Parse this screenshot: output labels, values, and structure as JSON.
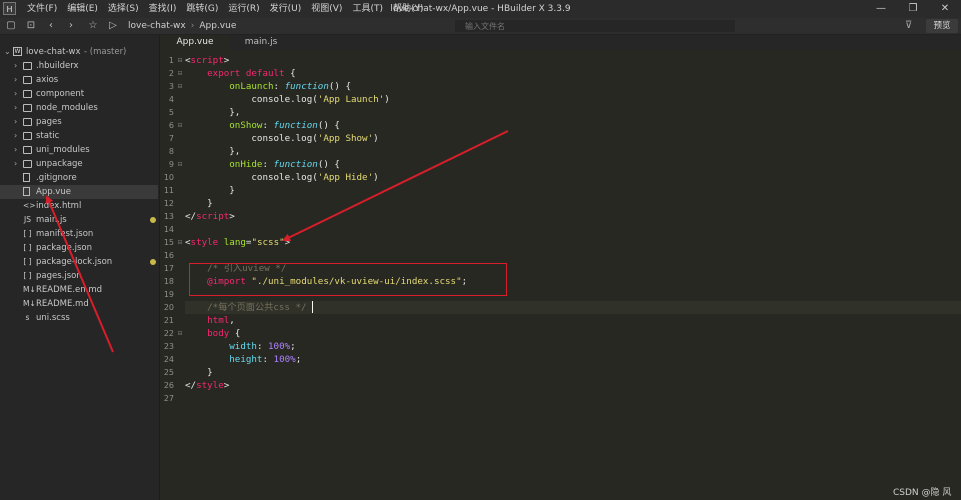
{
  "window": {
    "title": "love-chat-wx/App.vue - HBuilder X 3.3.9",
    "logo_text": "H",
    "controls": {
      "minimize": "—",
      "maximize": "❐",
      "close": "✕"
    }
  },
  "menu": [
    "文件(F)",
    "编辑(E)",
    "选择(S)",
    "查找(I)",
    "跳转(G)",
    "运行(R)",
    "发行(U)",
    "视图(V)",
    "工具(T)",
    "帮助(Y)"
  ],
  "toolbar": {
    "breadcrumb": [
      "love-chat-wx",
      "App.vue"
    ],
    "breadcrumb_sep": "›",
    "search_placeholder": "输入文件名",
    "preview_label": "预览"
  },
  "sidebar": {
    "project": {
      "name": "love-chat-wx",
      "branch": "- (master)",
      "icon": "W"
    },
    "items": [
      {
        "label": ".hbuilderx",
        "type": "folder"
      },
      {
        "label": "axios",
        "type": "folder"
      },
      {
        "label": "component",
        "type": "folder"
      },
      {
        "label": "node_modules",
        "type": "folder"
      },
      {
        "label": "pages",
        "type": "folder"
      },
      {
        "label": "static",
        "type": "folder"
      },
      {
        "label": "uni_modules",
        "type": "folder"
      },
      {
        "label": "unpackage",
        "type": "folder"
      },
      {
        "label": ".gitignore",
        "type": "file",
        "icon": "file-icon"
      },
      {
        "label": "App.vue",
        "type": "file",
        "icon": "vue-file-icon",
        "selected": true
      },
      {
        "label": "index.html",
        "type": "file",
        "icon": "html-file-icon",
        "glyph": "<>"
      },
      {
        "label": "main.js",
        "type": "file",
        "icon": "js-file-icon",
        "glyph": "JS",
        "modified": true
      },
      {
        "label": "manifest.json",
        "type": "file",
        "icon": "json-file-icon",
        "glyph": "[ ]"
      },
      {
        "label": "package.json",
        "type": "file",
        "icon": "json-file-icon",
        "glyph": "[ ]"
      },
      {
        "label": "package-lock.json",
        "type": "file",
        "icon": "json-file-icon",
        "glyph": "[ ]",
        "modified": true
      },
      {
        "label": "pages.json",
        "type": "file",
        "icon": "json-file-icon",
        "glyph": "[ ]"
      },
      {
        "label": "README.en.md",
        "type": "file",
        "icon": "markdown-file-icon",
        "glyph": "M↓"
      },
      {
        "label": "README.md",
        "type": "file",
        "icon": "markdown-file-icon",
        "glyph": "M↓"
      },
      {
        "label": "uni.scss",
        "type": "file",
        "icon": "scss-file-icon",
        "glyph": "ꜱ"
      }
    ]
  },
  "tabs": [
    {
      "label": "App.vue",
      "active": true
    },
    {
      "label": "main.js",
      "active": false
    }
  ],
  "editor": {
    "line_numbers": [
      "1",
      "2",
      "3",
      "4",
      "5",
      "6",
      "7",
      "8",
      "9",
      "10",
      "11",
      "12",
      "13",
      "14",
      "15",
      "16",
      "17",
      "18",
      "19",
      "20",
      "21",
      "22",
      "23",
      "24",
      "25",
      "26",
      "27"
    ],
    "current_line": 20,
    "lines": [
      [
        [
          "tk-plain",
          "<"
        ],
        [
          "tk-tag",
          "script"
        ],
        [
          "tk-plain",
          ">"
        ]
      ],
      [
        [
          "tk-plain",
          "    "
        ],
        [
          "tk-kw",
          "export default"
        ],
        [
          "tk-plain",
          " {"
        ]
      ],
      [
        [
          "tk-plain",
          "        "
        ],
        [
          "tk-fn",
          "onLaunch"
        ],
        [
          "tk-plain",
          ": "
        ],
        [
          "tk-fnkw",
          "function"
        ],
        [
          "tk-plain",
          "() {"
        ]
      ],
      [
        [
          "tk-plain",
          "            console."
        ],
        [
          "tk-plain",
          "log"
        ],
        [
          "tk-plain",
          "("
        ],
        [
          "tk-str",
          "'App Launch'"
        ],
        [
          "tk-plain",
          ")"
        ]
      ],
      [
        [
          "tk-plain",
          "        },"
        ]
      ],
      [
        [
          "tk-plain",
          "        "
        ],
        [
          "tk-fn",
          "onShow"
        ],
        [
          "tk-plain",
          ": "
        ],
        [
          "tk-fnkw",
          "function"
        ],
        [
          "tk-plain",
          "() {"
        ]
      ],
      [
        [
          "tk-plain",
          "            console."
        ],
        [
          "tk-plain",
          "log"
        ],
        [
          "tk-plain",
          "("
        ],
        [
          "tk-str",
          "'App Show'"
        ],
        [
          "tk-plain",
          ")"
        ]
      ],
      [
        [
          "tk-plain",
          "        },"
        ]
      ],
      [
        [
          "tk-plain",
          "        "
        ],
        [
          "tk-fn",
          "onHide"
        ],
        [
          "tk-plain",
          ": "
        ],
        [
          "tk-fnkw",
          "function"
        ],
        [
          "tk-plain",
          "() {"
        ]
      ],
      [
        [
          "tk-plain",
          "            console."
        ],
        [
          "tk-plain",
          "log"
        ],
        [
          "tk-plain",
          "("
        ],
        [
          "tk-str",
          "'App Hide'"
        ],
        [
          "tk-plain",
          ")"
        ]
      ],
      [
        [
          "tk-plain",
          "        }"
        ]
      ],
      [
        [
          "tk-plain",
          "    }"
        ]
      ],
      [
        [
          "tk-plain",
          "</"
        ],
        [
          "tk-tag",
          "script"
        ],
        [
          "tk-plain",
          ">"
        ]
      ],
      [],
      [
        [
          "tk-plain",
          "<"
        ],
        [
          "tk-tag",
          "style"
        ],
        [
          "tk-plain",
          " "
        ],
        [
          "tk-attr",
          "lang"
        ],
        [
          "tk-plain",
          "="
        ],
        [
          "tk-str",
          "\"scss\""
        ],
        [
          "tk-plain",
          ">"
        ]
      ],
      [],
      [
        [
          "tk-plain",
          "    "
        ],
        [
          "tk-cm",
          "/* 引入uview */"
        ]
      ],
      [
        [
          "tk-plain",
          "    "
        ],
        [
          "tk-kw",
          "@import"
        ],
        [
          "tk-plain",
          " "
        ],
        [
          "tk-str",
          "\"./uni_modules/vk-uview-ui/index.scss\""
        ],
        [
          "tk-plain",
          ";"
        ]
      ],
      [],
      [
        [
          "tk-plain",
          "    "
        ],
        [
          "tk-cm",
          "/*每个页面公共css */"
        ]
      ],
      [
        [
          "tk-plain",
          "    "
        ],
        [
          "tk-tag",
          "html"
        ],
        [
          "tk-plain",
          ","
        ]
      ],
      [
        [
          "tk-plain",
          "    "
        ],
        [
          "tk-tag",
          "body"
        ],
        [
          "tk-plain",
          " {"
        ]
      ],
      [
        [
          "tk-plain",
          "        "
        ],
        [
          "tk-prop",
          "width"
        ],
        [
          "tk-plain",
          ": "
        ],
        [
          "tk-num",
          "100%"
        ],
        [
          "tk-plain",
          ";"
        ]
      ],
      [
        [
          "tk-plain",
          "        "
        ],
        [
          "tk-prop",
          "height"
        ],
        [
          "tk-plain",
          ": "
        ],
        [
          "tk-num",
          "100%"
        ],
        [
          "tk-plain",
          ";"
        ]
      ],
      [
        [
          "tk-plain",
          "    }"
        ]
      ],
      [
        [
          "tk-plain",
          "</"
        ],
        [
          "tk-tag",
          "style"
        ],
        [
          "tk-plain",
          ">"
        ]
      ],
      []
    ],
    "foldable_lines": [
      1,
      2,
      3,
      6,
      9,
      15,
      22
    ]
  },
  "watermark": "CSDN @隐 风",
  "colors": {
    "annotation_red": "#d81e2a",
    "modified_dot": "#c9b94a"
  }
}
